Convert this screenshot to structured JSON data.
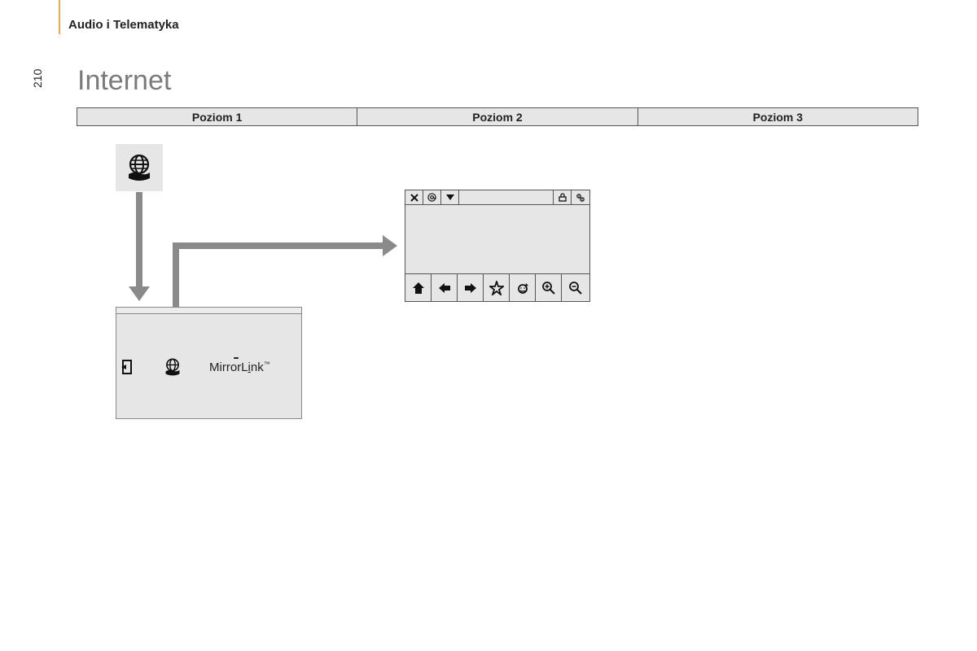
{
  "section": "Audio i Telematyka",
  "page_number": "210",
  "title": "Internet",
  "levels": [
    "Poziom 1",
    "Poziom 2",
    "Poziom 3"
  ],
  "icons": {
    "globe": "globe-hand-icon",
    "globe_small": "globe-hand-icon",
    "exit": "exit-icon",
    "mirrorlink": "MirrorLink"
  },
  "browser_top": {
    "close": "close-icon",
    "at": "at-icon",
    "down": "dropdown-icon",
    "lock": "lock-icon",
    "gears": "settings-icon"
  },
  "browser_bottom": {
    "home": "home-icon",
    "back": "back-icon",
    "forward": "forward-icon",
    "favorite": "star-icon",
    "refresh": "refresh-icon",
    "zoom_in": "zoom-in-icon",
    "zoom_out": "zoom-out-icon"
  }
}
